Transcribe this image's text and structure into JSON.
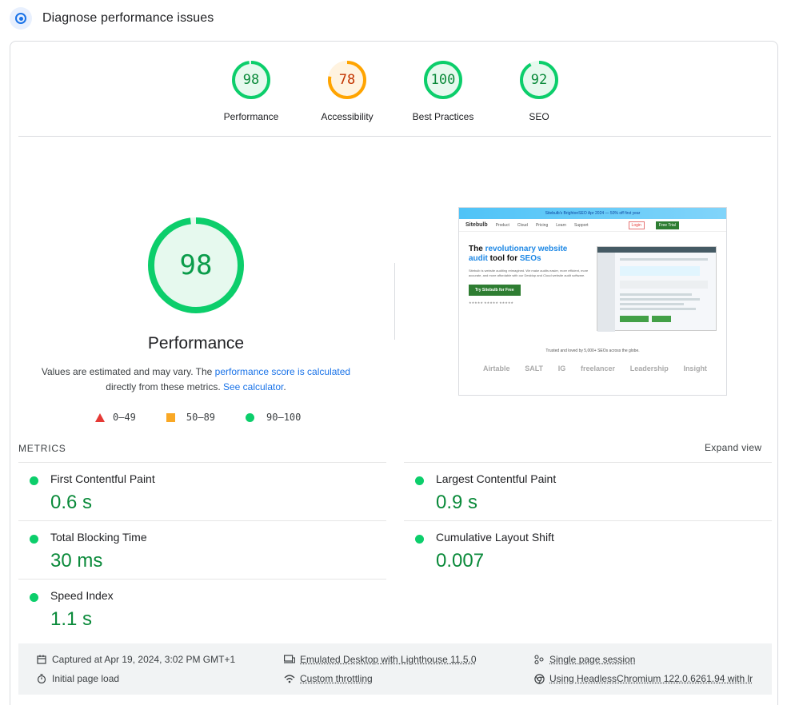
{
  "header": {
    "title": "Diagnose performance issues",
    "icon": "speed-target-icon"
  },
  "gauges": [
    {
      "label": "Performance",
      "score": "98",
      "score_value": 98,
      "color": "#0cce6b",
      "text_color": "#0a8a3a",
      "fill": "#e6f9ee"
    },
    {
      "label": "Accessibility",
      "score": "78",
      "score_value": 78,
      "color": "#ffa400",
      "text_color": "#c33300",
      "fill": "#fff3e0"
    },
    {
      "label": "Best Practices",
      "score": "100",
      "score_value": 100,
      "color": "#0cce6b",
      "text_color": "#0a8a3a",
      "fill": "#e6f9ee"
    },
    {
      "label": "SEO",
      "score": "92",
      "score_value": 92,
      "color": "#0cce6b",
      "text_color": "#0a8a3a",
      "fill": "#e6f9ee"
    }
  ],
  "main_score": {
    "score": "98",
    "score_value": 98,
    "title": "Performance",
    "desc_prefix": "Values are estimated and may vary. The ",
    "desc_link1": "performance score is calculated",
    "desc_mid": "directly from these metrics. ",
    "desc_link2": "See calculator",
    "desc_suffix": "."
  },
  "legend": {
    "fail": "0–49",
    "average": "50–89",
    "pass": "90–100",
    "colors": {
      "fail": "#e53935",
      "average": "#f9a825",
      "pass": "#0cce6b"
    }
  },
  "screenshot": {
    "banner": "Sitebulb's BrightonSEO Apr 2024 — 50% off first year",
    "logo": "Sitebulb",
    "nav": [
      "Product",
      "Cloud",
      "Pricing",
      "Learn",
      "Support"
    ],
    "login": "Login",
    "free": "Free Trial",
    "headline_a": "The ",
    "headline_b": "revolutionary website audit",
    "headline_c": " tool for ",
    "headline_d": "SEOs",
    "body": "Sitebulb is website auditing reimagined. We make audits easier, more efficient, more accurate, and more affordable with our Desktop and Cloud website audit software.",
    "cta": "Try Sitebulb for Free",
    "stars": "★★★★★ ★★★★★ ★★★★★",
    "trusted": "Trusted and loved by 5,000+ SEOs across the globe.",
    "logos": [
      "Airtable",
      "SALT",
      "IG",
      "freelancer",
      "Leadership",
      "Insight"
    ]
  },
  "metrics": {
    "title": "METRICS",
    "expand": "Expand view",
    "items": [
      {
        "name": "First Contentful Paint",
        "value": "0.6 s"
      },
      {
        "name": "Largest Contentful Paint",
        "value": "0.9 s"
      },
      {
        "name": "Total Blocking Time",
        "value": "30 ms"
      },
      {
        "name": "Cumulative Layout Shift",
        "value": "0.007"
      },
      {
        "name": "Speed Index",
        "value": "1.1 s"
      }
    ]
  },
  "footer": {
    "captured": "Captured at Apr 19, 2024, 3:02 PM GMT+1",
    "initial": "Initial page load",
    "emulated": "Emulated Desktop with Lighthouse 11.5.0",
    "throttling": "Custom throttling",
    "session": "Single page session",
    "browser": "Using HeadlessChromium 122.0.6261.94 with lr"
  }
}
